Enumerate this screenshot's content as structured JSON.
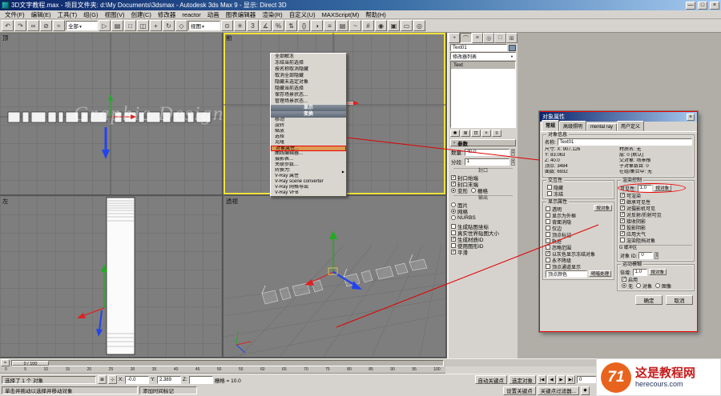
{
  "window": {
    "title": "3D文字教程.max - 项目文件夹: d:\\My Documents\\3dsmax - Autodesk 3ds Max 9 - 显示: Direct 3D",
    "minimize_glyph": "—",
    "maximize_glyph": "□",
    "close_glyph": "×"
  },
  "menubar": {
    "items": [
      "文件(F)",
      "编辑(E)",
      "工具(T)",
      "组(G)",
      "视图(V)",
      "创建(C)",
      "修改器",
      "reactor",
      "动画",
      "图表编辑器",
      "渲染(R)",
      "自定义(U)",
      "MAXScript(M)",
      "帮助(H)"
    ]
  },
  "toolbar": {
    "icons_left": [
      {
        "name": "undo-icon",
        "glyph": "↶"
      },
      {
        "name": "redo-icon",
        "glyph": "↷"
      },
      {
        "name": "select-link-icon",
        "glyph": "∞"
      },
      {
        "name": "unlink-icon",
        "glyph": "⊘"
      },
      {
        "name": "bind-spacewarp-icon",
        "glyph": "≈"
      }
    ],
    "selection_filter_value": "全部",
    "icons_mid": [
      {
        "name": "select-object-icon",
        "glyph": "▷"
      },
      {
        "name": "select-by-name-icon",
        "glyph": "▤"
      },
      {
        "name": "selection-region-icon",
        "glyph": "□"
      },
      {
        "name": "window-crossing-icon",
        "glyph": "◫"
      },
      {
        "name": "select-move-icon",
        "glyph": "+"
      },
      {
        "name": "select-rotate-icon",
        "glyph": "↻"
      },
      {
        "name": "select-scale-icon",
        "glyph": "◇"
      }
    ],
    "ref_coord_value": "视图",
    "icons_right": [
      {
        "name": "use-pivot-icon",
        "glyph": "⊙"
      },
      {
        "name": "select-manipulate-icon",
        "glyph": "✳"
      },
      {
        "name": "snap-toggle-icon",
        "glyph": "3"
      },
      {
        "name": "angle-snap-icon",
        "glyph": "∡"
      },
      {
        "name": "percent-snap-icon",
        "glyph": "%"
      },
      {
        "name": "spinner-snap-icon",
        "glyph": "⇅"
      },
      {
        "name": "named-selection-icon",
        "glyph": "{}"
      },
      {
        "name": "mirror-icon",
        "glyph": "◑"
      },
      {
        "name": "align-icon",
        "glyph": "≡"
      },
      {
        "name": "layer-manager-icon",
        "glyph": "▤"
      },
      {
        "name": "curve-editor-icon",
        "glyph": "~"
      },
      {
        "name": "schematic-view-icon",
        "glyph": "#"
      },
      {
        "name": "material-editor-icon",
        "glyph": "◉"
      },
      {
        "name": "render-setup-icon",
        "glyph": "▣"
      },
      {
        "name": "render-type-icon",
        "glyph": "▭"
      },
      {
        "name": "quick-render-icon",
        "glyph": "◎"
      }
    ]
  },
  "viewports": {
    "top_left_label": "顶",
    "top_right_label": "前",
    "bottom_left_label": "左",
    "bottom_right_label": "透视",
    "overlay_watermark": "Graphic Design"
  },
  "quad_menu": {
    "top_items": [
      "全部解冻",
      "冻结当前选择",
      "按名称取消隐藏",
      "取消全部隐藏",
      "隐藏未选定对象",
      "隐藏当前选择",
      "保存场景状态...",
      "管理场景状态..."
    ],
    "header_display": "显示",
    "header_transform": "变换",
    "bottom_items": [
      {
        "label": "移动"
      },
      {
        "label": "旋转"
      },
      {
        "label": "缩放"
      },
      {
        "label": "选择"
      },
      {
        "label": "克隆"
      },
      {
        "label": "对象属性...",
        "highlight": true
      },
      {
        "label": "曲线编辑器..."
      },
      {
        "label": "摄影表..."
      },
      {
        "label": "关联参数..."
      },
      {
        "label": "转换为:",
        "submenu": true
      },
      {
        "label": "V-Ray 属性"
      },
      {
        "label": "V-Ray scene converter"
      },
      {
        "label": "V-Ray 网格导出"
      },
      {
        "label": "V-Ray VFB"
      }
    ]
  },
  "command_panel": {
    "tabs": [
      {
        "name": "create-tab-icon",
        "glyph": "+"
      },
      {
        "name": "modify-tab-icon",
        "glyph": "⌒",
        "active": true
      },
      {
        "name": "hierarchy-tab-icon",
        "glyph": "≡"
      },
      {
        "name": "motion-tab-icon",
        "glyph": "◎"
      },
      {
        "name": "display-tab-icon",
        "glyph": "□"
      },
      {
        "name": "utilities-tab-icon",
        "glyph": "⊞"
      }
    ],
    "object_name": "Text01",
    "modifier_list_label": "修改器列表",
    "dropdown_arrow": "▼",
    "stack_items": [
      {
        "label": "Text",
        "selected": true
      }
    ],
    "stack_buttons": [
      {
        "name": "pin-stack-icon",
        "glyph": "✱"
      },
      {
        "name": "show-end-result-icon",
        "glyph": "≣"
      },
      {
        "name": "make-unique-icon",
        "glyph": "⊡"
      },
      {
        "name": "remove-modifier-icon",
        "glyph": "×"
      },
      {
        "name": "configure-modifier-icon",
        "glyph": "≡"
      }
    ],
    "rollout_title": "参数",
    "rollout_state": "-",
    "amount_label": "数量:",
    "amount_value": "40.0",
    "segments_label": "分段:",
    "segments_value": "1",
    "cap_group_label": "封口",
    "cap_checkboxes": [
      {
        "label": "封口始端",
        "checked": true
      },
      {
        "label": "封口末端",
        "checked": true
      }
    ],
    "cap_radios": [
      {
        "label": "变形",
        "selected": true
      },
      {
        "label": "栅格"
      }
    ],
    "output_group_label": "输出",
    "output_radios": [
      {
        "label": "面片"
      },
      {
        "label": "网格",
        "selected": true
      },
      {
        "label": "NURBS"
      }
    ],
    "gen_checkboxes": [
      {
        "label": "生成贴图坐标"
      },
      {
        "label": "真实世界贴图大小"
      },
      {
        "label": "生成材质ID",
        "checked": true
      },
      {
        "label": "使用图形ID"
      },
      {
        "label": "平滑",
        "checked": true
      }
    ]
  },
  "dialog": {
    "title": "对象属性",
    "close_glyph": "×",
    "tabs": [
      {
        "label": "常规",
        "active": true
      },
      {
        "label": "高级照明"
      },
      {
        "label": "mental ray"
      },
      {
        "label": "用户定义"
      }
    ],
    "info": {
      "group_label": "对象信息",
      "name_label": "名称:",
      "name_value": "Text01",
      "left_rows": [
        "尺寸: X: 907.126",
        "Y: 83.063",
        "Z: 40.0",
        "顶点: 3484",
        "面数: 6932"
      ],
      "right_rows": [
        "材质名: 无",
        "层: 0 (默认)",
        "父对象: 场景根",
        "子对象数目: 0",
        "在组/集合中: 无"
      ]
    },
    "interactivity": {
      "group_label": "交互性",
      "items": [
        {
          "label": "隐藏"
        },
        {
          "label": "冻结"
        }
      ]
    },
    "display_props": {
      "group_label": "显示属性",
      "by_object_label": "按对象",
      "items": [
        {
          "label": "透明"
        },
        {
          "label": "显示为外框"
        },
        {
          "label": "背面消隐"
        },
        {
          "label": "仅边"
        },
        {
          "label": "顶点标记"
        },
        {
          "label": "轨迹"
        },
        {
          "label": "忽略范围"
        },
        {
          "label": "以灰色显示冻结对象",
          "checked": true
        },
        {
          "label": "永不降级"
        },
        {
          "label": "顶点通道显示"
        }
      ],
      "vertex_channel_value": "顶点颜色",
      "shaded_label": "明暗处理"
    },
    "render_control": {
      "group_label": "渲染控制",
      "visibility_label": "可见性:",
      "visibility_value": "1.0",
      "by_object_label": "按对象",
      "items": [
        {
          "label": "可渲染",
          "checked": true
        },
        {
          "label": "继承可见性",
          "checked": true
        },
        {
          "label": "对摄影机可见",
          "checked": true
        },
        {
          "label": "对反射/折射可见",
          "checked": true
        },
        {
          "label": "接收阴影",
          "checked": true
        },
        {
          "label": "投影阴影",
          "checked": true
        },
        {
          "label": "应用大气",
          "checked": true
        },
        {
          "label": "渲染阻挡对象"
        }
      ],
      "gbuffer_label": "G 缓冲区",
      "object_id_label": "对象 ID:",
      "object_id_value": "0"
    },
    "motion_blur": {
      "group_label": "运动模糊",
      "multiplier_label": "倍增:",
      "multiplier_value": "1.0",
      "by_object_label": "按对象",
      "enabled": {
        "label": "启用",
        "checked": true
      },
      "radios": [
        {
          "label": "无",
          "selected": true
        },
        {
          "label": "对象"
        },
        {
          "label": "图像"
        }
      ]
    },
    "ok_label": "确定",
    "cancel_label": "取消"
  },
  "timeline": {
    "curve_editor_glyph": "≈",
    "slider_label": "0 / 100",
    "ticks": [
      "0",
      "5",
      "10",
      "15",
      "20",
      "25",
      "30",
      "35",
      "40",
      "45",
      "50",
      "55",
      "60",
      "65",
      "70",
      "75",
      "80",
      "85",
      "90",
      "95",
      "100"
    ]
  },
  "statusbar": {
    "selection_text": "选择了 1 个 对象",
    "lock_glyph": "⊠",
    "xform_glyph": "⊹",
    "x_label": "X:",
    "x_value": "-0.0",
    "y_label": "Y:",
    "y_value": "2.389",
    "z_label": "Z:",
    "z_value": "",
    "grid_text": "栅格 = 10.0",
    "prompt_text": "单击并拖动以选择并移动对象",
    "time_tag_text": "添加时间标记",
    "auto_key_label": "自动关键点",
    "set_key_label": "设置关键点",
    "selected_label": "选定对象",
    "key_filters_label": "关键点过滤器...",
    "key_mode_glyph": "◆",
    "frame_value": "0",
    "playback": [
      {
        "name": "go-start-icon",
        "glyph": "|◀"
      },
      {
        "name": "prev-frame-icon",
        "glyph": "◀"
      },
      {
        "name": "play-icon",
        "glyph": "▶"
      },
      {
        "name": "next-frame-icon",
        "glyph": "▶|"
      }
    ]
  },
  "site_watermark": {
    "logo_text": "71",
    "site_name": "这是教程网",
    "site_url": "herecours.com"
  }
}
